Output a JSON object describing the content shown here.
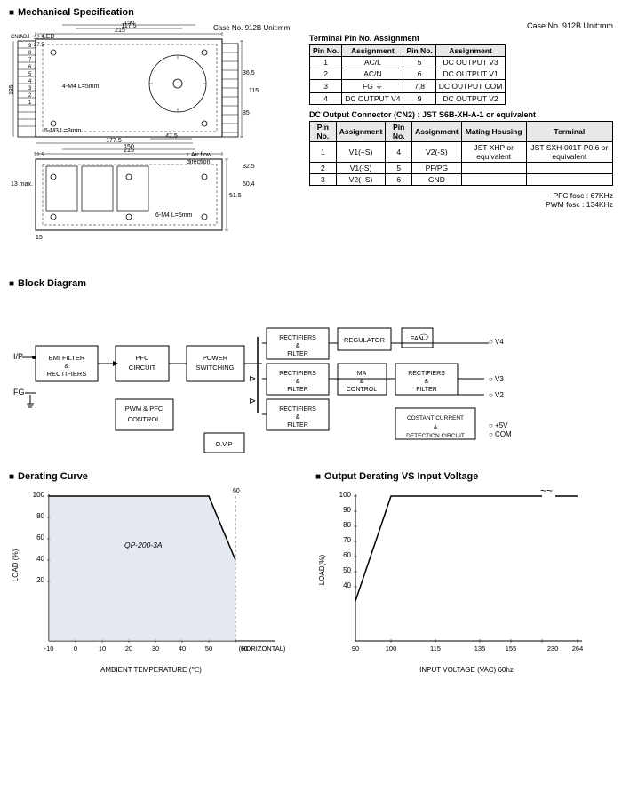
{
  "sections": {
    "mechanical": {
      "title": "Mechanical Specification"
    },
    "blockDiagram": {
      "title": "Block Diagram"
    },
    "deratingCurve": {
      "title": "Derating Curve"
    },
    "outputDerating": {
      "title": "Output Derating VS Input Voltage"
    }
  },
  "caseInfo": {
    "text": "Case No. 912B  Unit:mm"
  },
  "tables": {
    "terminal": {
      "title": "Terminal Pin No. Assignment",
      "headers": [
        "Pin No.",
        "Assignment",
        "Pin No.",
        "Assignment"
      ],
      "rows": [
        [
          "1",
          "AC/L",
          "5",
          "DC OUTPUT V3"
        ],
        [
          "2",
          "AC/N",
          "6",
          "DC OUTPUT V1"
        ],
        [
          "3",
          "FG ⏚",
          "7,8",
          "DC OUTPUT COM"
        ],
        [
          "4",
          "DC OUTPUT V4",
          "9",
          "DC OUTPUT V2"
        ]
      ]
    },
    "dcConnector": {
      "title": "DC Output Connector (CN2) : JST S6B-XH-A-1 or equivalent",
      "headers": [
        "Pin No.",
        "Assignment",
        "Pin No.",
        "Assignment",
        "Mating Housing",
        "Terminal"
      ],
      "rows": [
        [
          "1",
          "V1(+S)",
          "4",
          "V2(-S)",
          "JST XHP or equivalent",
          "JST SXH-001T-P0.6 or equivalent"
        ],
        [
          "2",
          "V1(-S)",
          "5",
          "PF/PG",
          "",
          ""
        ],
        [
          "3",
          "V2(+S)",
          "6",
          "GND",
          "",
          ""
        ]
      ]
    }
  },
  "pfcInfo": {
    "pfc": "PFC fosc : 67KHz",
    "pwm": "PWM fosc : 134KHz"
  },
  "deratingCurve": {
    "modelLabel": "QP-200-3A",
    "xAxisTitle": "AMBIENT TEMPERATURE (℃)",
    "yAxisTitle": "LOAD (%)"
  },
  "outputDerating": {
    "xAxisTitle": "INPUT VOLTAGE (VAC) 60hz",
    "yAxisTitle": "LOAD(%)"
  }
}
